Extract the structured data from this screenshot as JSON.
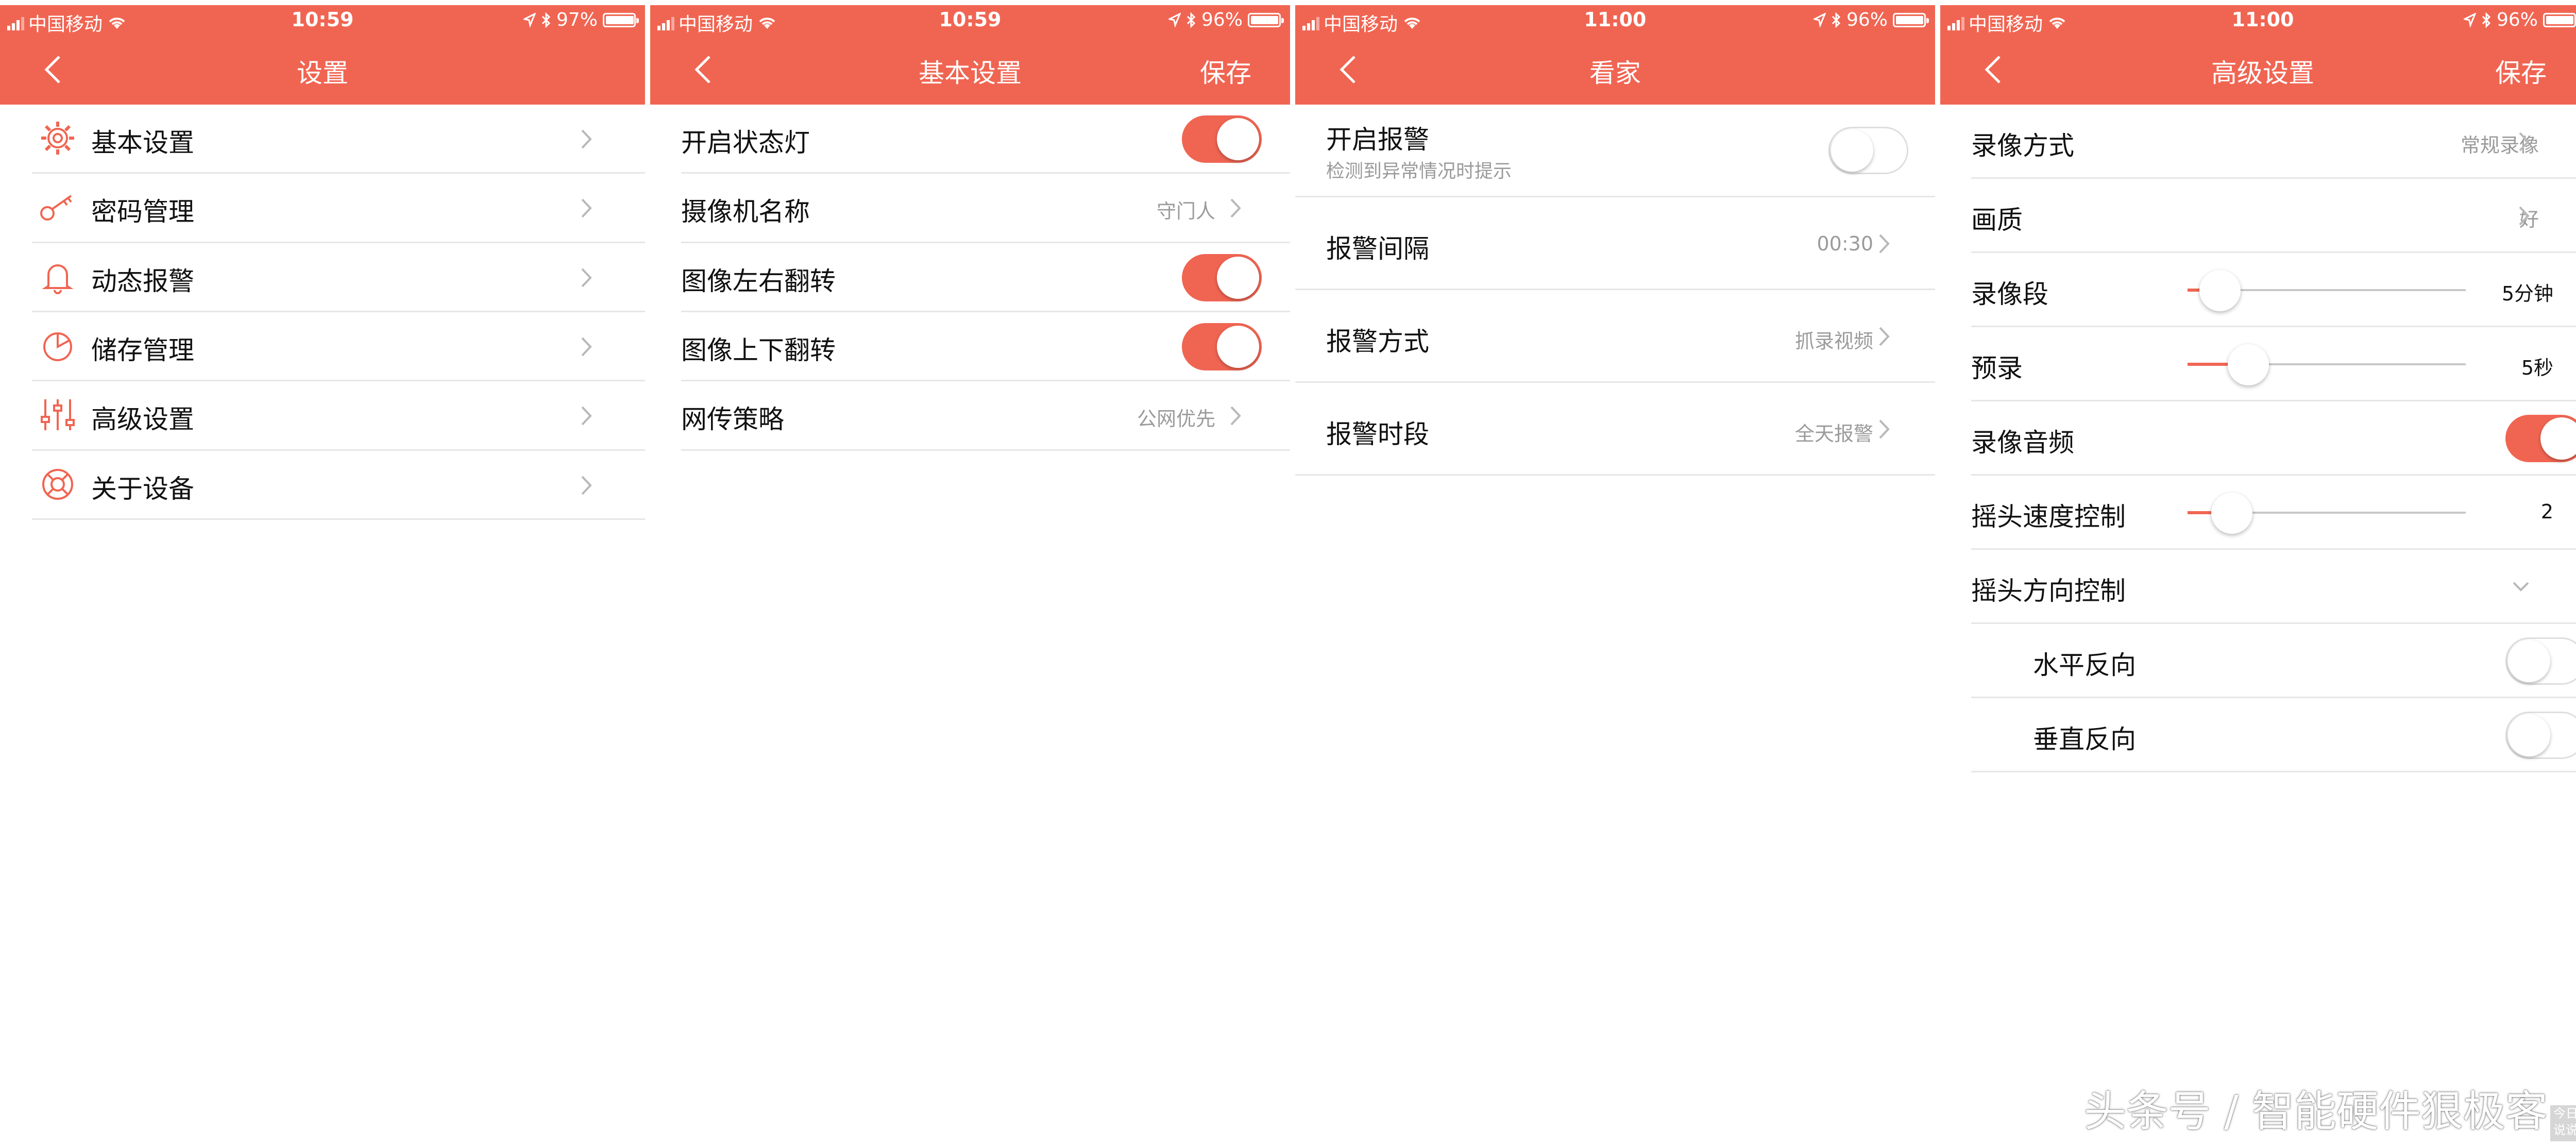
{
  "screens": [
    {
      "status": {
        "carrier": "中国移动",
        "time": "10:59",
        "battery": "97%",
        "battery_level": 0.97
      },
      "nav": {
        "title": "设置",
        "save": ""
      },
      "menu": [
        {
          "label": "基本设置",
          "icon": "gear-icon"
        },
        {
          "label": "密码管理",
          "icon": "key-icon"
        },
        {
          "label": "动态报警",
          "icon": "bell-icon"
        },
        {
          "label": "储存管理",
          "icon": "pie-chart-icon"
        },
        {
          "label": "高级设置",
          "icon": "sliders-icon"
        },
        {
          "label": "关于设备",
          "icon": "lifebuoy-icon"
        }
      ]
    },
    {
      "status": {
        "carrier": "中国移动",
        "time": "10:59",
        "battery": "96%",
        "battery_level": 0.96
      },
      "nav": {
        "title": "基本设置",
        "save": "保存"
      },
      "rows": [
        {
          "label": "开启状态灯",
          "toggle": true
        },
        {
          "label": "摄像机名称",
          "value": "守门人"
        },
        {
          "label": "图像左右翻转",
          "toggle": true
        },
        {
          "label": "图像上下翻转",
          "toggle": true
        },
        {
          "label": "网传策略",
          "value": "公网优先"
        }
      ]
    },
    {
      "status": {
        "carrier": "中国移动",
        "time": "11:00",
        "battery": "96%",
        "battery_level": 0.96
      },
      "nav": {
        "title": "看家",
        "save": ""
      },
      "alarm": {
        "label": "开启报警",
        "sub": "检测到异常情况时提示",
        "toggle": false
      },
      "rows": [
        {
          "label": "报警间隔",
          "value": "00:30"
        },
        {
          "label": "报警方式",
          "value": "抓录视频"
        },
        {
          "label": "报警时段",
          "value": "全天报警"
        }
      ]
    },
    {
      "status": {
        "carrier": "中国移动",
        "time": "11:00",
        "battery": "96%",
        "battery_level": 0.96
      },
      "nav": {
        "title": "高级设置",
        "save": "保存"
      },
      "rows": [
        {
          "label": "录像方式",
          "value": "常规录像"
        },
        {
          "label": "画质",
          "value": "好"
        },
        {
          "label": "录像段",
          "slider_value": "5分钟",
          "slider_fraction": 0.05
        },
        {
          "label": "预录",
          "slider_value": "5秒",
          "slider_fraction": 0.17
        },
        {
          "label": "录像音频",
          "toggle": true
        },
        {
          "label": "摇头速度控制",
          "slider_value": "2",
          "slider_fraction": 0.1
        },
        {
          "label": "摇头方向控制",
          "expanded": true
        },
        {
          "label": "水平反向",
          "toggle": false
        },
        {
          "label": "垂直反向",
          "toggle": false
        }
      ]
    }
  ],
  "colors": {
    "accent": "#f06552",
    "divider": "#e6e6e6",
    "secondary_text": "#9b9b9b"
  },
  "watermark": "头条号 / 智能硬件狠极客",
  "corner_badge": "今日说说"
}
